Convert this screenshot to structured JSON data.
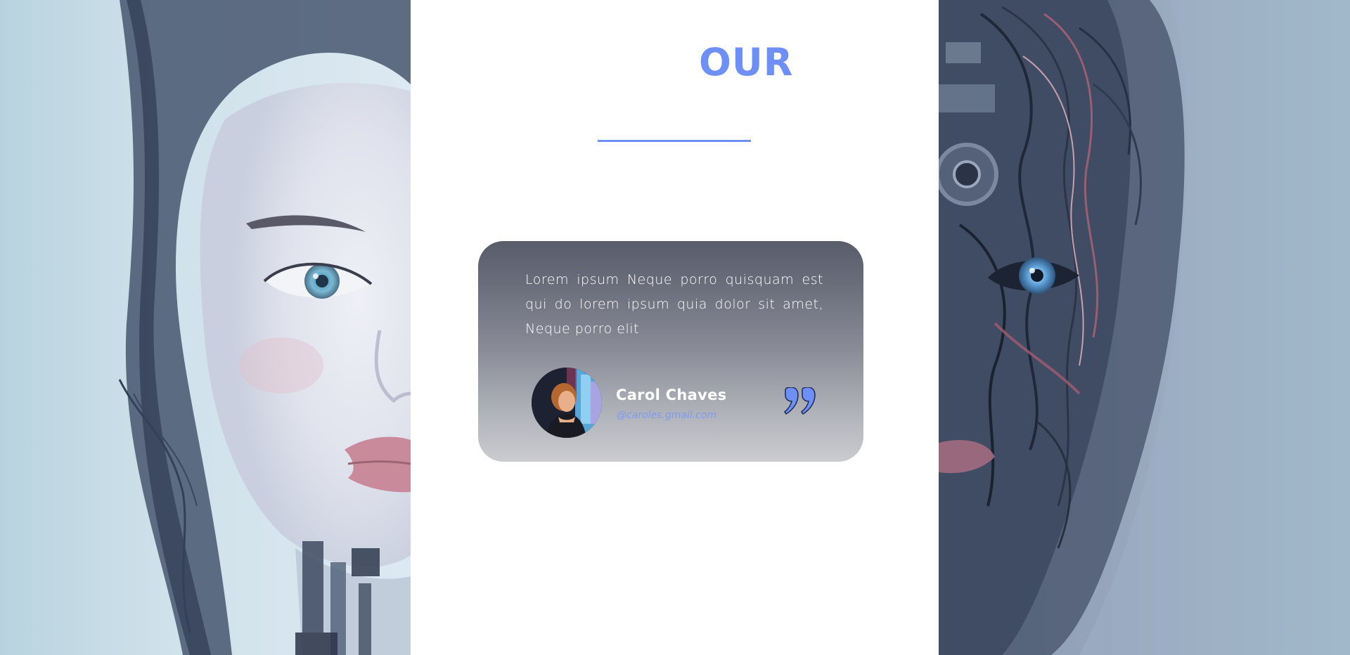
{
  "heading": {
    "title": "OUR"
  },
  "testimonial": {
    "quote": "Lorem ipsum Neque porro quisquam est qui do lorem ipsum quia dolor sit amet,  Neque porro elit",
    "author_name": "Carol Chaves",
    "author_email": "@caroles.gmail.com"
  },
  "colors": {
    "accent": "#6e8ff5",
    "card_top": "#595d6b",
    "card_bottom": "#cbcbd0",
    "email": "#7e99f1"
  },
  "icons": {
    "quote": "closing-quote-icon",
    "avatar": "user-avatar"
  }
}
